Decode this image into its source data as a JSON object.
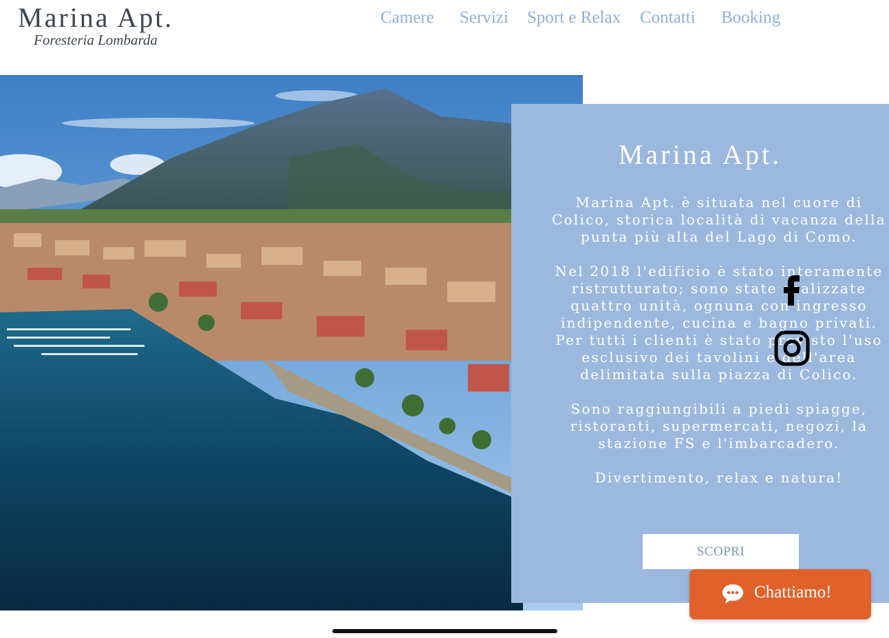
{
  "brand": {
    "title": "Marina Apt.",
    "subtitle": "Foresteria Lombarda"
  },
  "nav": {
    "items": [
      {
        "label": "Camere"
      },
      {
        "label": "Servizi"
      },
      {
        "label": "Sport e Relax"
      },
      {
        "label": "Contatti"
      },
      {
        "label": "Booking"
      }
    ]
  },
  "panel": {
    "title": "Marina Apt.",
    "paragraphs": [
      "Marina Apt. è situata nel cuore di Colico, storica località di vacanza della punta più alta del Lago di Como.",
      "Nel 2018 l'edificio è stato interamente ristrutturato; sono state realizzate quattro unità, ognuna con ingresso indipendente, cucina e bagno privati. Per tutti i clienti è stato previsto l'uso esclusivo dei tavolini e dell'area delimitata sulla piazza di Colico.",
      "Sono raggiungibili a piedi spiagge, ristoranti, supermercati, negozi, la stazione FS e l'imbarcadero.",
      "Divertimento, relax e natura!"
    ],
    "button_label": "SCOPRI"
  },
  "social": {
    "facebook_icon": "facebook-icon",
    "instagram_icon": "instagram-icon"
  },
  "chat": {
    "label": "Chattiamo!",
    "icon": "chat-bubble-icon"
  },
  "colors": {
    "nav": "#8fb0d4",
    "panel": "#9db8de",
    "chat": "#e0622a",
    "brand_text": "#3d4650"
  }
}
